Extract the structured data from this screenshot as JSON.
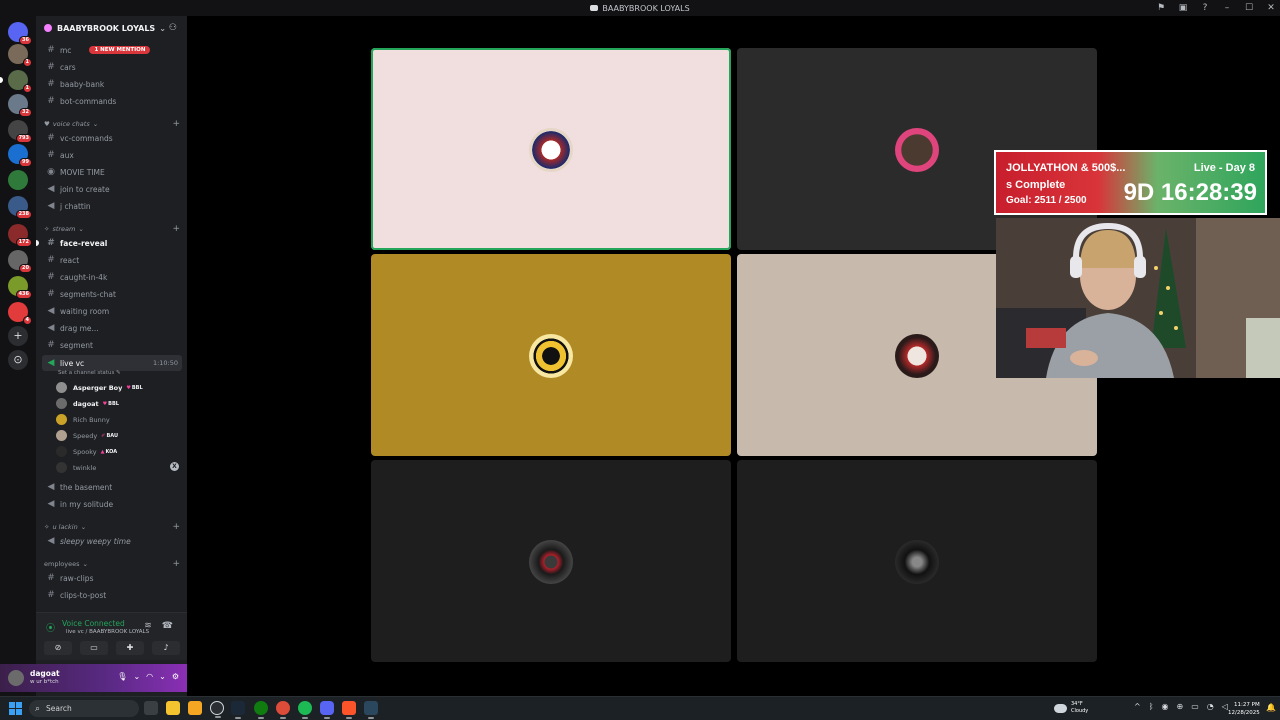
{
  "window": {
    "title": "BAABYBROOK LOYALS",
    "controls": {
      "minimize": "–",
      "maximize": "☐",
      "close": "✕"
    },
    "top_icons": [
      "flag-icon",
      "inbox-icon",
      "help-icon"
    ]
  },
  "rail": {
    "servers": [
      {
        "name": "direct-messages",
        "badge": "36",
        "color": "#5865f2"
      },
      {
        "name": "server-1",
        "badge": "1",
        "color": "#7a6a5a"
      },
      {
        "name": "server-baabybrook",
        "badge": "1",
        "color": "#5a6b4a",
        "active": true
      },
      {
        "name": "server-3",
        "badge": "32",
        "color": "#6b7a8a"
      },
      {
        "name": "server-4",
        "badge": "793",
        "color": "#444"
      },
      {
        "name": "server-5",
        "badge": "99",
        "color": "#1b6fd1"
      },
      {
        "name": "server-6",
        "badge": "",
        "color": "#2f7a3a"
      },
      {
        "name": "server-7",
        "badge": "238",
        "color": "#3a5a8a"
      },
      {
        "name": "server-8",
        "badge": "172",
        "color": "#8a2a2a"
      },
      {
        "name": "server-9",
        "badge": "20",
        "color": "#666"
      },
      {
        "name": "server-10",
        "badge": "436",
        "color": "#7a9a2a"
      },
      {
        "name": "server-11",
        "badge": "4",
        "color": "#e23b3b"
      }
    ],
    "add_label": "+",
    "discover_label": "⊙"
  },
  "sidebar": {
    "server_name": "BAABYBROOK LOYALS",
    "channels_top": [
      {
        "name": "mc",
        "mention": "1 NEW MENTION"
      },
      {
        "name": "cars"
      },
      {
        "name": "baaby-bank"
      },
      {
        "name": "bot-commands"
      }
    ],
    "cat_voice": "voice chats",
    "voice_chats": [
      {
        "name": "vc-commands",
        "type": "text"
      },
      {
        "name": "aux",
        "type": "text"
      },
      {
        "name": "MOVIE TIME",
        "type": "stage"
      },
      {
        "name": "join to create",
        "type": "voice"
      },
      {
        "name": "j chattin",
        "type": "voice"
      }
    ],
    "cat_stream": "stream",
    "stream": [
      {
        "name": "face-reveal",
        "type": "text",
        "bold": true
      },
      {
        "name": "react",
        "type": "text"
      },
      {
        "name": "caught-in-4k",
        "type": "text"
      },
      {
        "name": "segments-chat",
        "type": "text"
      },
      {
        "name": "waiting room",
        "type": "voice"
      },
      {
        "name": "drag me...",
        "type": "voice"
      },
      {
        "name": "segment",
        "type": "text"
      }
    ],
    "live_vc": {
      "name": "live vc",
      "timer": "1:10:50",
      "status": "Set a channel status ✎"
    },
    "voice_users": [
      {
        "name": "Asperger Boy",
        "tag": "BBL",
        "on": true,
        "color": "#8f8f8f"
      },
      {
        "name": "dagoat",
        "tag": "BBL",
        "on": true,
        "color": "#6b6b6b"
      },
      {
        "name": "Rich Bunny",
        "tag": "",
        "on": false,
        "color": "#c9a227"
      },
      {
        "name": "Speedy",
        "tag": "BAU",
        "on": false,
        "color": "#b0a090"
      },
      {
        "name": "Spooky",
        "tag": "KOA",
        "on": false,
        "color": "#2a2a2a"
      },
      {
        "name": "twinkle",
        "tag": "",
        "on": false,
        "color": "#333"
      }
    ],
    "after_vc": [
      {
        "name": "the basement",
        "type": "voice"
      },
      {
        "name": "in my solitude",
        "type": "voice"
      }
    ],
    "cat_slackin": "u lackin",
    "slackin": [
      {
        "name": "sleepy weepy time",
        "type": "voice"
      }
    ],
    "cat_employees": "employees",
    "employees": [
      {
        "name": "raw-clips",
        "type": "text"
      },
      {
        "name": "clips-to-post",
        "type": "text"
      }
    ]
  },
  "voice_panel": {
    "title": "Voice Connected",
    "subtitle": "live vc / BAABYBROOK LOYALS"
  },
  "user_panel": {
    "username": "dagoat",
    "status": "w ur b*tch"
  },
  "overlay": {
    "line1": "JOLLYATHON & 500$...",
    "line2": "s Complete",
    "goal": "Goal: 2511 / 2500",
    "live": "Live - Day 8",
    "timer": "9D 16:28:39"
  },
  "tiles": [
    {
      "bg": "#f1dede",
      "speaking": true,
      "avatar": "patriots-logo"
    },
    {
      "bg": "#2b2b2b",
      "speaking": false,
      "avatar": "pink-frame-avatar"
    },
    {
      "bg": "#b08a25",
      "speaking": false,
      "avatar": "bruins-logo"
    },
    {
      "bg": "#c7b9ab",
      "speaking": false,
      "avatar": "joker-avatar"
    },
    {
      "bg": "#1e1e1e",
      "speaking": false,
      "avatar": "masked-avatar"
    },
    {
      "bg": "#1e1e1e",
      "speaking": false,
      "avatar": "dark-avatar"
    }
  ],
  "taskbar": {
    "search": "Search",
    "temp": "34°F",
    "condition": "Cloudy",
    "time": "11:27 PM",
    "date": "12/28/2025"
  }
}
